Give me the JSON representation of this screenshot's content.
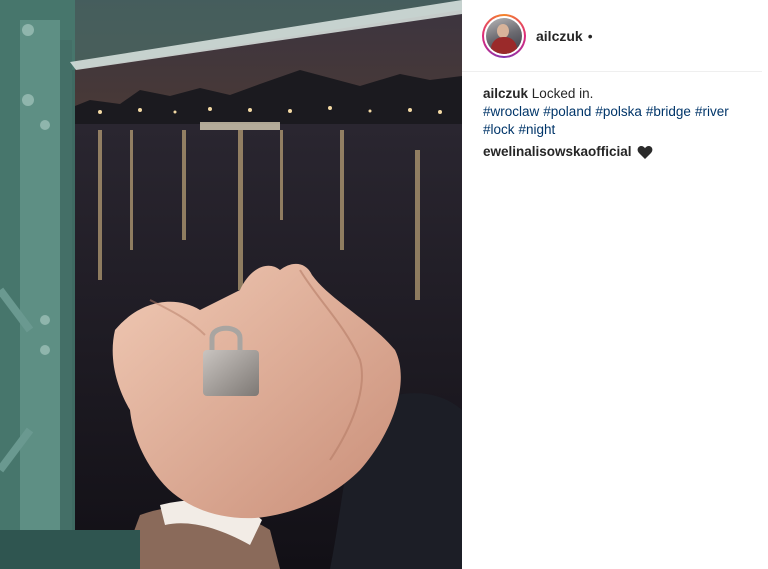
{
  "post": {
    "author": {
      "username": "ailczuk",
      "separator": "•"
    },
    "caption": {
      "username": "ailczuk",
      "text": "Locked in.",
      "hashtags": [
        "#wroclaw",
        "#poland",
        "#polska",
        "#bridge",
        "#river",
        "#lock",
        "#night"
      ]
    },
    "comments": [
      {
        "username": "ewelinalisowskaofficial",
        "emoji": "black-heart-icon"
      }
    ]
  },
  "colors": {
    "hashtag": "#003569",
    "text": "#262626",
    "divider": "#efefef",
    "bridge_steel": "#5e8f84"
  },
  "photo": {
    "description_icon": "photo-hands-holding-padlock"
  }
}
